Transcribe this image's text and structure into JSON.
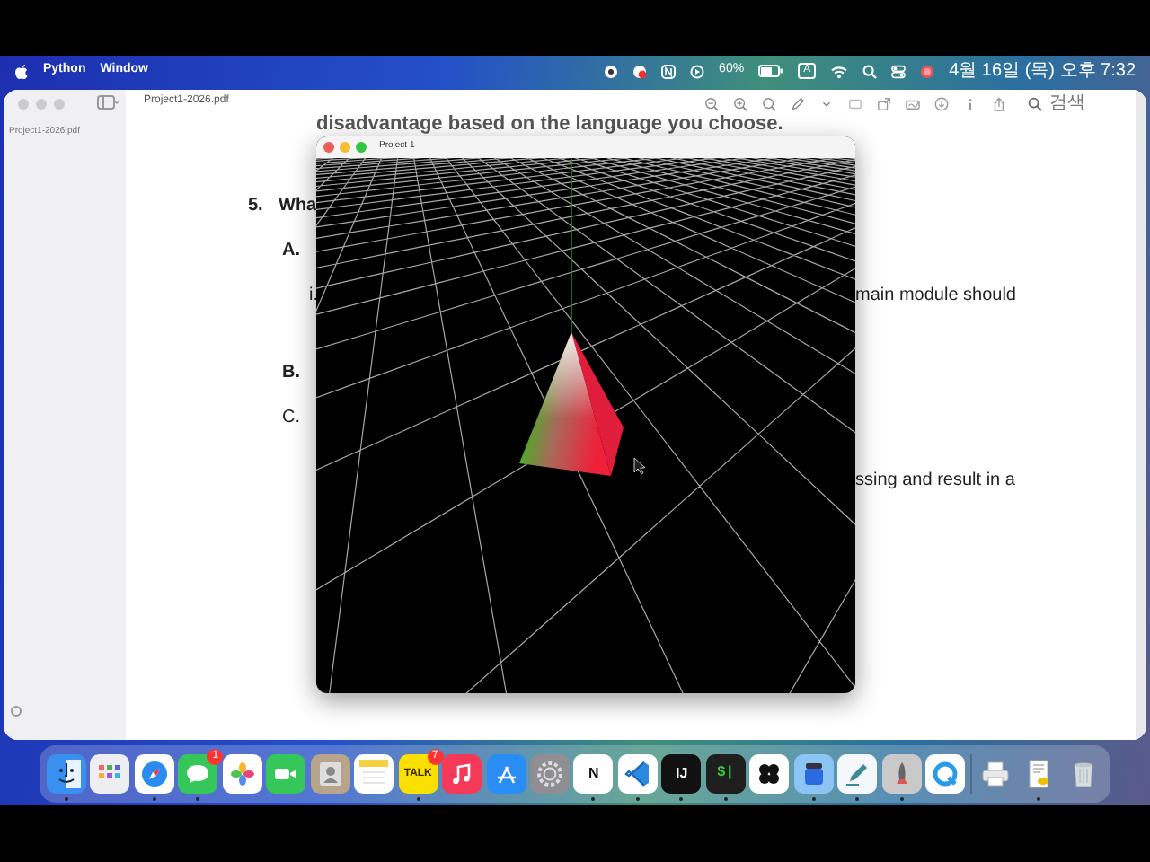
{
  "menu_bar": {
    "items": [
      "Python",
      "Window"
    ],
    "battery": "60%",
    "input_source": "A",
    "clock": "4월 16일 (목) 오후 7:32"
  },
  "preview": {
    "title": "Project1-2026.pdf",
    "search_placeholder": "검색",
    "sidebar_pages": [
      {
        "label": "Project1-2026.pdf",
        "selected": false
      }
    ]
  },
  "document": {
    "lines": [
      {
        "kind": "intro",
        "text": "disadvantage based on the language you choose."
      },
      {
        "kind": "question",
        "label": "5.",
        "text": "Wha"
      },
      {
        "kind": "part",
        "label": "A.",
        "bold": true
      },
      {
        "kind": "subpart",
        "label": "i.",
        "text": "main module should"
      },
      {
        "kind": "part",
        "label": "B.",
        "bold": true
      },
      {
        "kind": "part",
        "label": "C.",
        "bold": false
      },
      {
        "kind": "fragment",
        "text": "ssing and result in a"
      }
    ]
  },
  "project_window": {
    "title": "Project 1"
  },
  "dock": {
    "items": [
      {
        "kind": "face",
        "running": true
      },
      {
        "kind": "app-grid",
        "running": false
      },
      {
        "kind": "compass",
        "running": true
      },
      {
        "kind": "chat",
        "running": true,
        "badge": "1"
      },
      {
        "kind": "flower",
        "running": false
      },
      {
        "kind": "camera",
        "running": false
      },
      {
        "kind": "contact",
        "running": false
      },
      {
        "kind": "notepad",
        "running": false
      },
      {
        "kind": "talk",
        "glyph": "TALK",
        "running": true,
        "badge": "7"
      },
      {
        "kind": "music",
        "running": false
      },
      {
        "kind": "letter-a",
        "running": false
      },
      {
        "kind": "gear",
        "running": false
      },
      {
        "kind": "glyph-light",
        "glyph": "N",
        "running": true
      },
      {
        "kind": "ribbon",
        "running": true
      },
      {
        "kind": "glyph-ide",
        "glyph": "IJ",
        "running": true
      },
      {
        "kind": "glyph-terminal",
        "glyph": "$|",
        "running": true
      },
      {
        "kind": "clover",
        "running": false
      },
      {
        "kind": "jar",
        "running": true
      },
      {
        "kind": "pen",
        "running": true
      },
      {
        "kind": "rocket",
        "running": true
      },
      {
        "kind": "ring",
        "running": false
      },
      {
        "kind": "separator"
      },
      {
        "kind": "printer",
        "running": false
      },
      {
        "kind": "document",
        "running": true
      },
      {
        "kind": "trash",
        "running": false
      }
    ]
  }
}
